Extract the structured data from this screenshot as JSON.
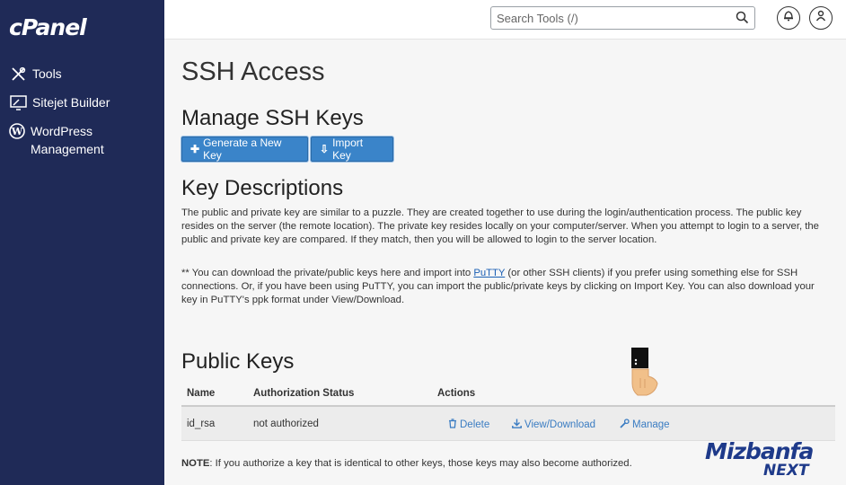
{
  "brand": {
    "logo_text": "cPanel"
  },
  "sidebar": {
    "items": [
      {
        "label": "Tools",
        "icon": "tools-icon"
      },
      {
        "label": "Sitejet Builder",
        "icon": "monitor-icon"
      },
      {
        "label": "WordPress Management",
        "icon": "wordpress-icon"
      }
    ]
  },
  "header": {
    "search_placeholder": "Search Tools (/)",
    "icons": [
      "search-icon",
      "bell-icon",
      "user-icon"
    ]
  },
  "page": {
    "title": "SSH Access",
    "manage_heading": "Manage SSH Keys",
    "generate_button": "Generate a New Key",
    "import_button": "Import Key",
    "descriptions_heading": "Key Descriptions",
    "description_text": "The public and private key are similar to a puzzle. They are created together to use during the login/authentication process. The public key resides on the server (the remote location). The private key resides locally on your computer/server. When you attempt to login to a server, the public and private key are compared. If they match, then you will be allowed to login to the server location.",
    "putty_prefix": "** You can download the private/public keys here and import into ",
    "putty_link": "PuTTY",
    "putty_suffix": " (or other SSH clients) if you prefer using something else for SSH connections. Or, if you have been using PuTTY, you can import the public/private keys by clicking on Import Key. You can also download your key in PuTTY's ppk format under View/Download.",
    "public_keys_heading": "Public Keys"
  },
  "table": {
    "headers": [
      "Name",
      "Authorization Status",
      "Actions"
    ],
    "rows": [
      {
        "name": "id_rsa",
        "status": "not authorized",
        "actions": {
          "delete": "Delete",
          "view": "View/Download",
          "manage": "Manage"
        }
      }
    ]
  },
  "note": {
    "label": "NOTE",
    "text": ": If you authorize a key that is identical to other keys, those keys may also become authorized."
  },
  "watermark": {
    "line1": "Mizbanfa",
    "line2": "NEXT"
  }
}
